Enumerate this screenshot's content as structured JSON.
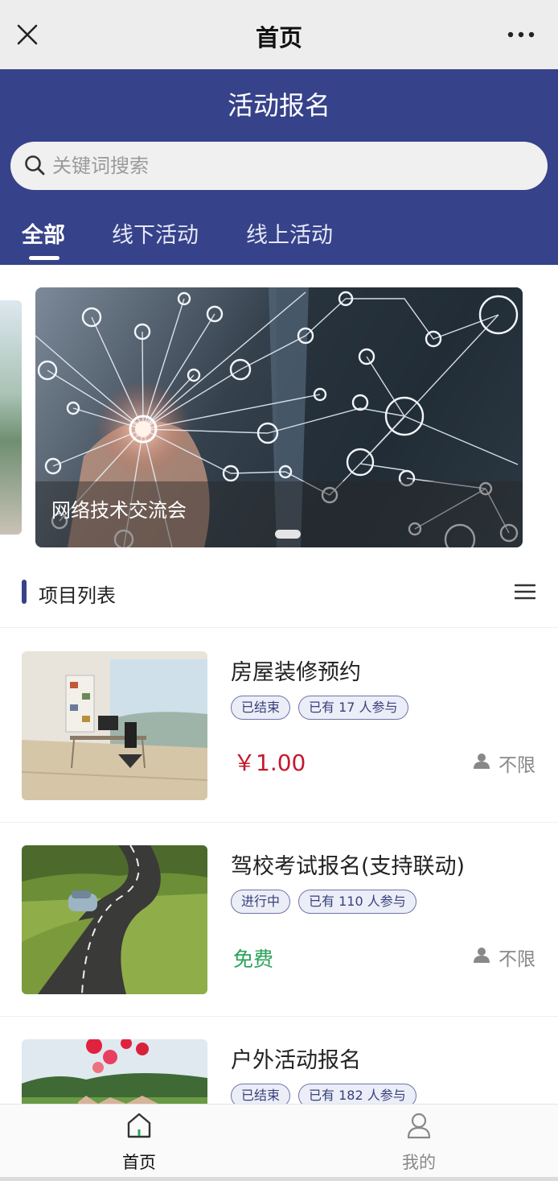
{
  "topbar": {
    "title": "首页",
    "close_icon": "close-icon",
    "more_icon": "more-icon"
  },
  "header": {
    "title": "活动报名"
  },
  "search": {
    "placeholder": "关键词搜索",
    "icon": "search-icon"
  },
  "tabs": [
    {
      "label": "全部",
      "active": true
    },
    {
      "label": "线下活动",
      "active": false
    },
    {
      "label": "线上活动",
      "active": false
    }
  ],
  "banner": {
    "caption": "网络技术交流会",
    "slide_index": 1
  },
  "section": {
    "title": "项目列表",
    "menu_icon": "menu-icon"
  },
  "items": [
    {
      "name": "房屋装修预约",
      "status": "已结束",
      "participants": "已有 17 人参与",
      "price": "￥1.00",
      "limit": "不限"
    },
    {
      "name": "驾校考试报名(支持联动)",
      "status": "进行中",
      "participants": "已有 110 人参与",
      "price": "免费",
      "limit": "不限"
    },
    {
      "name": "户外活动报名",
      "status": "已结束",
      "participants": "已有 182 人参与"
    }
  ],
  "tabbar": [
    {
      "label": "首页",
      "icon": "home-icon",
      "active": true
    },
    {
      "label": "我的",
      "icon": "user-icon",
      "active": false
    }
  ],
  "colors": {
    "brand": "#36428a",
    "price": "#c4192e",
    "free": "#2aa35a"
  }
}
